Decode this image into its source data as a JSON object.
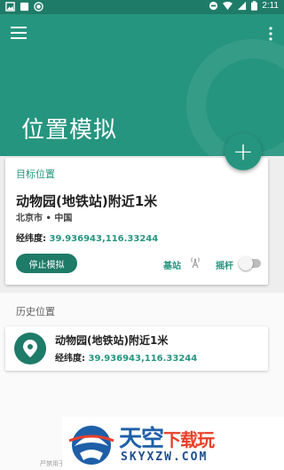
{
  "status_bar": {
    "time": "2:11",
    "icons": [
      "image-icon",
      "square-icon",
      "record-icon",
      "dnd-icon",
      "wifi-icon",
      "signal-icon",
      "battery-icon"
    ]
  },
  "app_bar": {
    "title": "位置模拟",
    "color": "#26957f",
    "menu_icon": "hamburger-menu-icon",
    "more_icon": "more-vert-icon",
    "fab_icon": "plus-icon",
    "fab_label": "+"
  },
  "target": {
    "section_label": "目标位置",
    "place_name": "动物园(地铁站)附近1米",
    "region": "北京市 • 中国",
    "coord_label": "经纬度:",
    "coord_value": "39.936943,116.33244",
    "stop_button": "停止模拟",
    "base_station_label": "基站",
    "joystick_label": "摇杆",
    "joystick_enabled": false
  },
  "history": {
    "title": "历史位置",
    "items": [
      {
        "name": "动物园(地铁站)附近1米",
        "coord_label": "经纬度:",
        "coord_value": "39.936943,116.33244"
      }
    ]
  },
  "footer_hint": "严禁用于",
  "watermark": {
    "brand_a": "天空",
    "brand_b": "下载玩",
    "url": "SKYXZW.COM"
  }
}
